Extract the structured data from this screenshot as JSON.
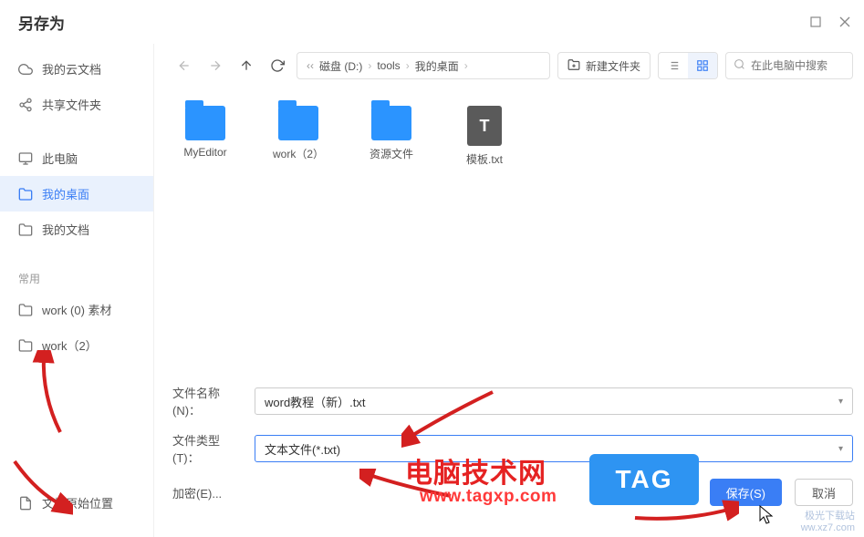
{
  "window": {
    "title": "另存为"
  },
  "sidebar": {
    "items": [
      {
        "label": "我的云文档"
      },
      {
        "label": "共享文件夹"
      },
      {
        "label": "此电脑"
      },
      {
        "label": "我的桌面"
      },
      {
        "label": "我的文档"
      }
    ],
    "recent_label": "常用",
    "recent": [
      {
        "label": "work (0) 素材"
      },
      {
        "label": "work（2）"
      }
    ],
    "bottom": {
      "label": "文档原始位置"
    }
  },
  "toolbar": {
    "breadcrumb": {
      "disk": "磁盘 (D:)",
      "p1": "tools",
      "p2": "我的桌面"
    },
    "new_folder": "新建文件夹",
    "search_placeholder": "在此电脑中搜索"
  },
  "files": [
    {
      "name": "MyEditor",
      "type": "folder"
    },
    {
      "name": "work（2）",
      "type": "folder"
    },
    {
      "name": "资源文件",
      "type": "folder"
    },
    {
      "name": "模板.txt",
      "type": "txt"
    }
  ],
  "form": {
    "name_label": "文件名称(N)：",
    "name_value": "word教程（新）.txt",
    "type_label": "文件类型(T)：",
    "type_value": "文本文件(*.txt)",
    "encrypt_label": "加密(E)...",
    "save": "保存(S)",
    "cancel": "取消"
  },
  "overlay": {
    "tag": "TAG",
    "txt1": "电脑技术网",
    "txt2": "www.tagxp.com",
    "watermark": "极光下载站\nww.xz7.com"
  }
}
